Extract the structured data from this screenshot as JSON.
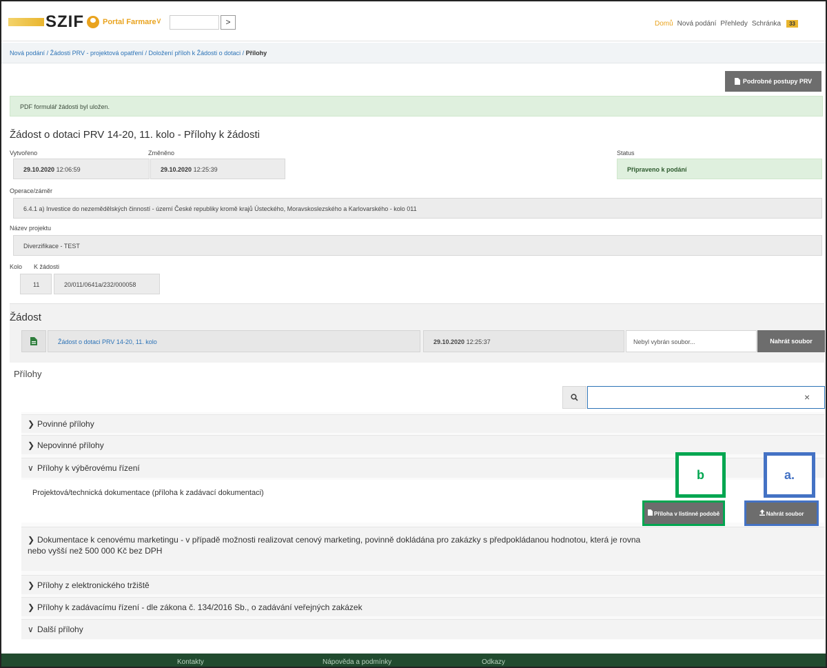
{
  "header": {
    "logo_text": "SZIF",
    "portal_label": "Portal Farmare",
    "top_search_placeholder": "",
    "nav": [
      "Domů",
      "Nová podání",
      "Přehledy",
      "Schránka"
    ],
    "badge_count": "33",
    "colors": {
      "accent": "#e9a31e",
      "link": "#2b72b6",
      "dark_button": "#6d6d6d",
      "footer": "#214b2f"
    },
    "icons": {
      "user": "user-circle-icon",
      "dropdown": "chevron-down-icon",
      "go": "chevron-right-icon"
    }
  },
  "breadcrumb": {
    "items": [
      "Nová podání",
      "Žádosti PRV - projektová opatření",
      "Doložení příloh k Žádosti o dotaci"
    ],
    "separator": "/",
    "current": "Přílohy"
  },
  "toolbar": {
    "guide_button": "Podrobné postupy PRV"
  },
  "alert": {
    "text": "PDF formulář žádosti byl uložen."
  },
  "page": {
    "title": "Žádost o dotaci PRV 14-20, 11. kolo - Přílohy k žádosti"
  },
  "info": {
    "created_label": "Vytvořeno",
    "created_date": "29.10.2020",
    "created_time": "12:06:59",
    "changed_label": "Změněno",
    "changed_date": "29.10.2020",
    "changed_time": "12:25:39",
    "status_label": "Status",
    "status_value": "Připraveno k podání",
    "operation_label": "Operace/záměr",
    "operation_value": "6.4.1 a) Investice do nezemědělských činností - území České republiky kromě krajů Ústeckého, Moravskoslezského a Karlovarského - kolo 011",
    "project_label": "Název projektu",
    "project_value": "Diverzifikace - TEST",
    "round_label": "Kolo",
    "round_value": "11",
    "ref_label": "K žádosti",
    "ref_value": "20/011/0641a/232/000058"
  },
  "zadost": {
    "title": "Žádost",
    "link_text": "Žádost o dotaci PRV 14-20, 11. kolo",
    "date": "29.10.2020",
    "time": "12:25:37",
    "file_placeholder": "Nebyl vybrán soubor...",
    "upload_label": "Nahrát soubor"
  },
  "prilohy": {
    "title": "Přílohy",
    "filter_value": "",
    "clear_symbol": "×",
    "sections": [
      {
        "label": "Povinné přílohy",
        "expanded": false
      },
      {
        "label": "Nepovinné přílohy",
        "expanded": false
      },
      {
        "label": "Přílohy k výběrovému řízení",
        "expanded": true
      },
      {
        "label": "Dokumentace k cenovému marketingu - v případě možnosti realizovat cenový marketing, povinně dokládána pro zakázky s předpokládanou hodnotou, která je rovna",
        "label_line2": "nebo vyšší než 500 000 Kč bez DPH",
        "expanded": false
      },
      {
        "label": "Přílohy z elektronického tržiště",
        "expanded": false
      },
      {
        "label": "Přílohy k zadávacímu řízení - dle zákona č. 134/2016 Sb., o zadávání veřejných zakázek",
        "expanded": false
      },
      {
        "label": "Další přílohy",
        "expanded": true
      }
    ],
    "expanded_item": {
      "label": "Projektová/technická dokumentace (příloha k zadávací dokumentaci)",
      "paper_button": "Příloha v listinné podobě",
      "upload_button": "Nahrát soubor"
    }
  },
  "markers": {
    "a": "a.",
    "b": "b",
    "colors": {
      "a": "#4472c4",
      "b": "#00a650"
    }
  },
  "footer": {
    "links": [
      "Kontakty",
      "Nápověda a podmínky",
      "Odkazy"
    ]
  }
}
